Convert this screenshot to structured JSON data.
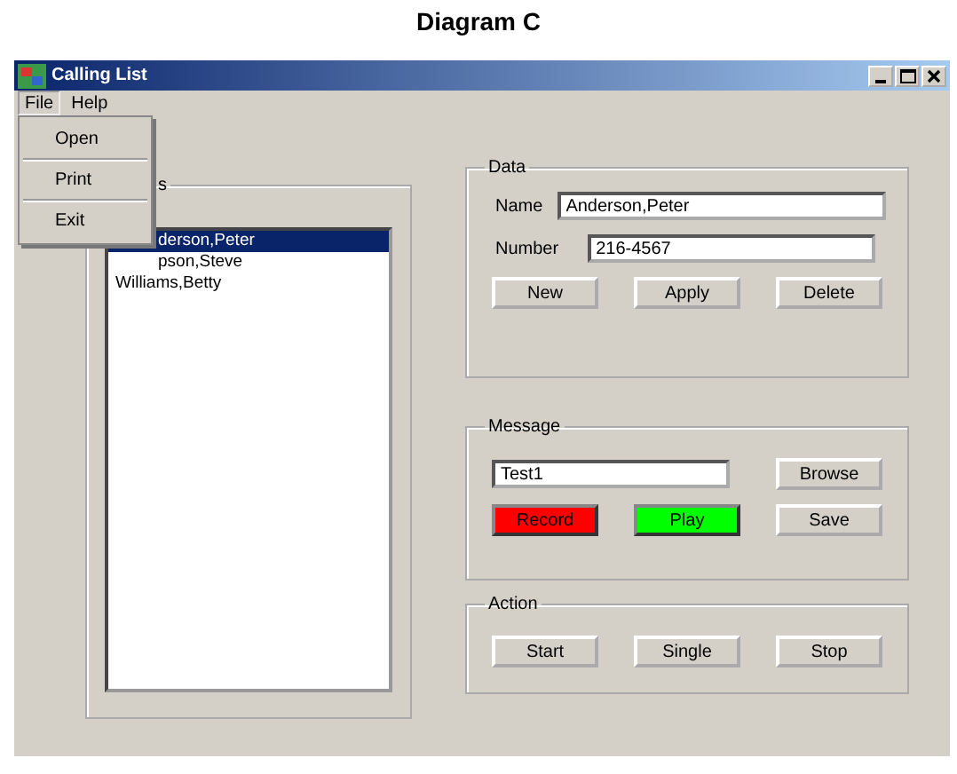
{
  "caption": "Diagram C",
  "window": {
    "title": "Calling List"
  },
  "menu_bar": [
    {
      "label": "File",
      "selected": true
    },
    {
      "label": "Help",
      "selected": false
    }
  ],
  "open_menu": {
    "items": [
      {
        "label": "Open"
      },
      {
        "label": "Print"
      },
      {
        "label": "Exit"
      }
    ]
  },
  "list_group": {
    "title": "s",
    "items": [
      {
        "label": "derson,Peter",
        "selected": true,
        "kind": "under_menu"
      },
      {
        "label": "pson,Steve",
        "selected": false,
        "kind": "under_menu"
      },
      {
        "label": "Williams,Betty",
        "selected": false,
        "kind": "plain"
      }
    ]
  },
  "data_group": {
    "title": "Data",
    "name_label": "Name",
    "name_value": "Anderson,Peter",
    "number_label": "Number",
    "number_value": "216-4567",
    "buttons": [
      "New",
      "Apply",
      "Delete"
    ]
  },
  "message_group": {
    "title": "Message",
    "value": "Test1",
    "browse": "Browse",
    "buttons": [
      {
        "label": "Record",
        "color": "#ff0000"
      },
      {
        "label": "Play",
        "color": "#00ff00"
      },
      {
        "label": "Save"
      }
    ]
  },
  "action_group": {
    "title": "Action",
    "buttons": [
      "Start",
      "Single",
      "Stop"
    ]
  }
}
